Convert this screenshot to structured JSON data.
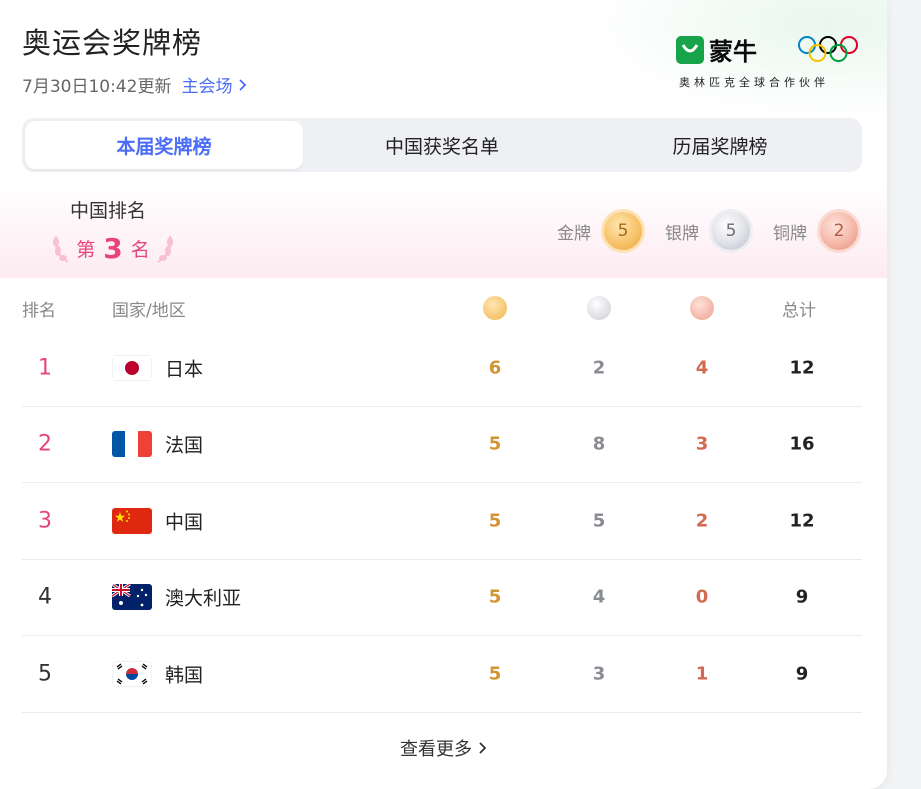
{
  "header": {
    "title": "奥运会奖牌榜",
    "update_time": "7月30日10:42更新",
    "venue_link": "主会场"
  },
  "sponsor": {
    "brand": "蒙牛",
    "partner_text": "奥林匹克全球合作伙伴"
  },
  "tabs": [
    {
      "label": "本届奖牌榜",
      "active": true
    },
    {
      "label": "中国获奖名单",
      "active": false
    },
    {
      "label": "历届奖牌榜",
      "active": false
    }
  ],
  "china_rank": {
    "label": "中国排名",
    "prefix": "第",
    "rank": "3",
    "suffix": "名",
    "gold_label": "金牌",
    "gold": "5",
    "silver_label": "银牌",
    "silver": "5",
    "bronze_label": "铜牌",
    "bronze": "2"
  },
  "table": {
    "headers": {
      "rank": "排名",
      "country": "国家/地区",
      "total": "总计"
    },
    "rows": [
      {
        "rank": "1",
        "country": "日本",
        "flag": "japan-flag",
        "gold": "6",
        "silver": "2",
        "bronze": "4",
        "total": "12"
      },
      {
        "rank": "2",
        "country": "法国",
        "flag": "france-flag",
        "gold": "5",
        "silver": "8",
        "bronze": "3",
        "total": "16"
      },
      {
        "rank": "3",
        "country": "中国",
        "flag": "china-flag",
        "gold": "5",
        "silver": "5",
        "bronze": "2",
        "total": "12"
      },
      {
        "rank": "4",
        "country": "澳大利亚",
        "flag": "australia-flag",
        "gold": "5",
        "silver": "4",
        "bronze": "0",
        "total": "9"
      },
      {
        "rank": "5",
        "country": "韩国",
        "flag": "korea-flag",
        "gold": "5",
        "silver": "3",
        "bronze": "1",
        "total": "9"
      }
    ]
  },
  "footer": {
    "more_label": "查看更多"
  },
  "colors": {
    "accent": "#4a6cf7",
    "rank_highlight": "#e8457f",
    "gold": "#d39433",
    "silver": "#8a8c93",
    "bronze": "#d26a52"
  }
}
